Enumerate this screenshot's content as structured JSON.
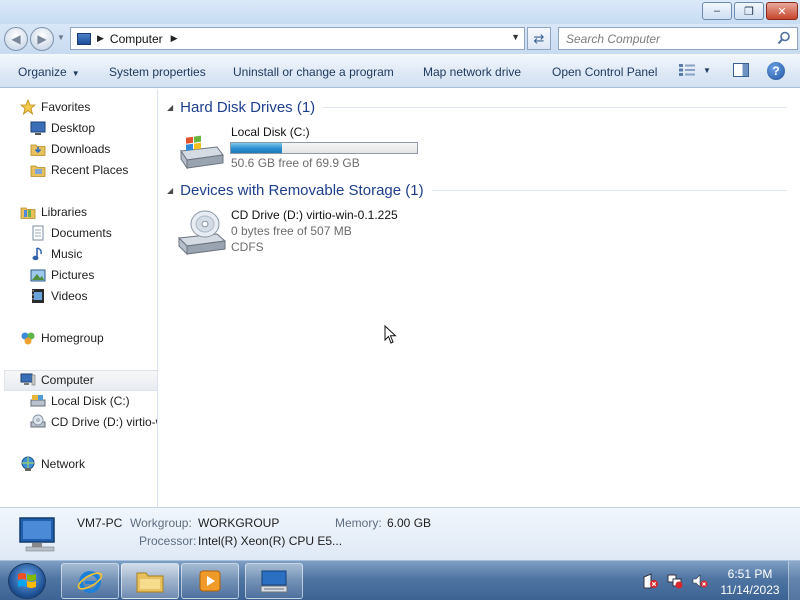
{
  "window": {
    "minimize_label": "–",
    "maximize_label": "❐",
    "close_label": "✕"
  },
  "address": {
    "location": "Computer",
    "search_placeholder": "Search Computer"
  },
  "toolbar": {
    "organize": "Organize",
    "system_properties": "System properties",
    "uninstall": "Uninstall or change a program",
    "map_drive": "Map network drive",
    "control_panel": "Open Control Panel",
    "help": "?"
  },
  "nav": {
    "favorites": "Favorites",
    "desktop": "Desktop",
    "downloads": "Downloads",
    "recent_places": "Recent Places",
    "libraries": "Libraries",
    "documents": "Documents",
    "music": "Music",
    "pictures": "Pictures",
    "videos": "Videos",
    "homegroup": "Homegroup",
    "computer": "Computer",
    "local_disk": "Local Disk (C:)",
    "cd_drive": "CD Drive (D:) virtio-w",
    "network": "Network"
  },
  "groups": {
    "hdd": "Hard Disk Drives (1)",
    "removable": "Devices with Removable Storage (1)"
  },
  "drives": {
    "c": {
      "name": "Local Disk (C:)",
      "free": "50.6 GB free of 69.9 GB",
      "used_fraction": 0.276
    },
    "d": {
      "name": "CD Drive (D:) virtio-win-0.1.225",
      "free": "0 bytes free of 507 MB",
      "fs": "CDFS"
    }
  },
  "details": {
    "name": "VM7-PC",
    "workgroup_label": "Workgroup:",
    "workgroup": "WORKGROUP",
    "memory_label": "Memory:",
    "memory": "6.00 GB",
    "processor_label": "Processor:",
    "processor": "Intel(R) Xeon(R) CPU E5..."
  },
  "taskbar": {
    "time": "6:51 PM",
    "date": "11/14/2023"
  },
  "colors": {
    "accent": "#1e3f8c",
    "toolbar_text": "#1e395b",
    "usage_fill": "#2a8ed0",
    "taskbar": "#4f75a3"
  }
}
